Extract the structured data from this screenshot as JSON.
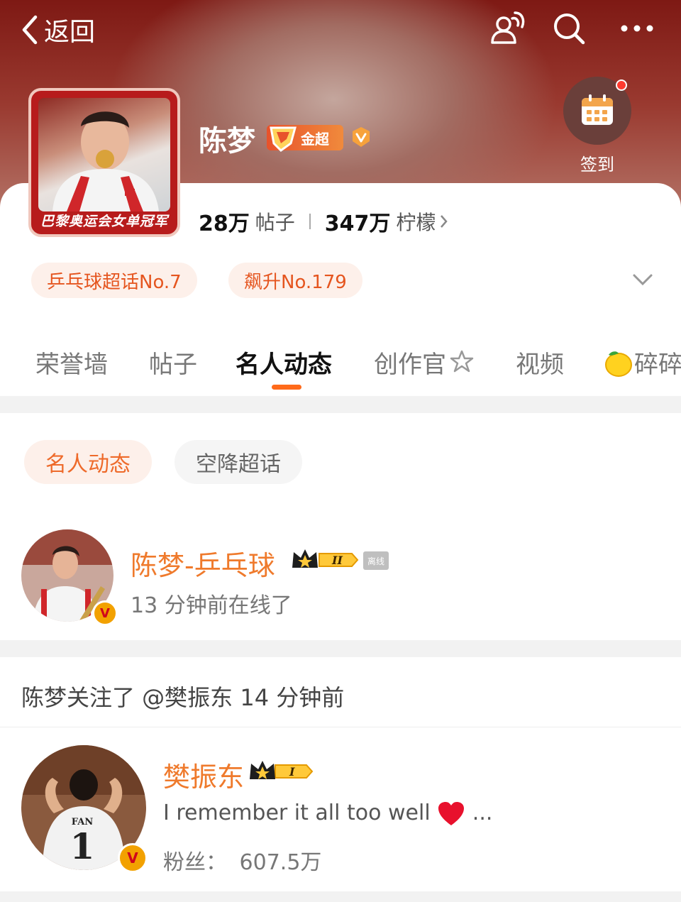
{
  "header": {
    "back_label": "返回",
    "checkin_label": "签到"
  },
  "profile": {
    "name": "陈梦",
    "badge_label": "金超",
    "avatar_caption": "巴黎奥运会女单冠军",
    "posts_count": "28万",
    "posts_label": "帖子",
    "lemons_count": "347万",
    "lemons_label": "柠檬",
    "tags": [
      "乒乓球超话No.7",
      "飙升No.179"
    ]
  },
  "tabs": [
    "荣誉墙",
    "帖子",
    "名人动态",
    "创作官",
    "视频",
    "碎碎"
  ],
  "active_tab": "名人动态",
  "filters": [
    "名人动态",
    "空降超话"
  ],
  "celebrity": {
    "name": "陈梦-乒乓球",
    "level": "II",
    "status_badge": "离线",
    "online_text": "13 分钟前在线了"
  },
  "activity": {
    "text": "陈梦关注了 @樊振东 14 分钟前"
  },
  "followed_user": {
    "name": "樊振东",
    "level": "I",
    "bio": "I remember it all too well",
    "bio_suffix": "...",
    "fans_label": "粉丝：",
    "fans_count": "607.5万",
    "jersey_name": "FAN",
    "jersey_number": "1"
  },
  "colors": {
    "accent": "#ff6a1a",
    "name_orange": "#ef7a2c",
    "header_red": "#7e1914"
  }
}
